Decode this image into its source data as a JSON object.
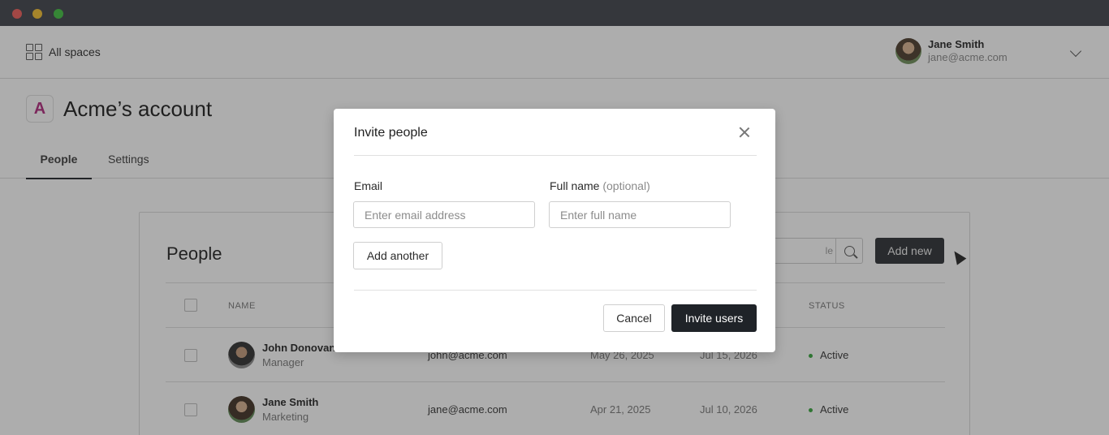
{
  "topbar": {
    "all_spaces": "All spaces"
  },
  "user": {
    "name": "Jane Smith",
    "email": "jane@acme.com"
  },
  "account": {
    "title": "Acme’s account",
    "logo_letter": "A"
  },
  "tabs": [
    {
      "label": "People"
    },
    {
      "label": "Settings"
    }
  ],
  "people_card": {
    "title": "People",
    "search_placeholder_visible": "le",
    "add_new_label": "Add new",
    "columns": {
      "name": "NAME",
      "status": "STATUS"
    },
    "rows": [
      {
        "name": "John Donovan",
        "role": "Manager",
        "email": "john@acme.com",
        "date1": "May 26, 2025",
        "date2": "Jul 15, 2026",
        "status": "Active"
      },
      {
        "name": "Jane Smith",
        "role": "Marketing",
        "email": "jane@acme.com",
        "date1": "Apr 21, 2025",
        "date2": "Jul 10, 2026",
        "status": "Active"
      }
    ]
  },
  "modal": {
    "title": "Invite people",
    "email_label": "Email",
    "email_placeholder": "Enter email address",
    "fullname_label": "Full name",
    "fullname_optional": "(optional)",
    "fullname_placeholder": "Enter full name",
    "add_another_label": "Add another",
    "cancel_label": "Cancel",
    "invite_label": "Invite users"
  },
  "colors": {
    "primary_dark": "#1f2328",
    "status_active": "#35a53a",
    "brand": "#b0287c"
  }
}
